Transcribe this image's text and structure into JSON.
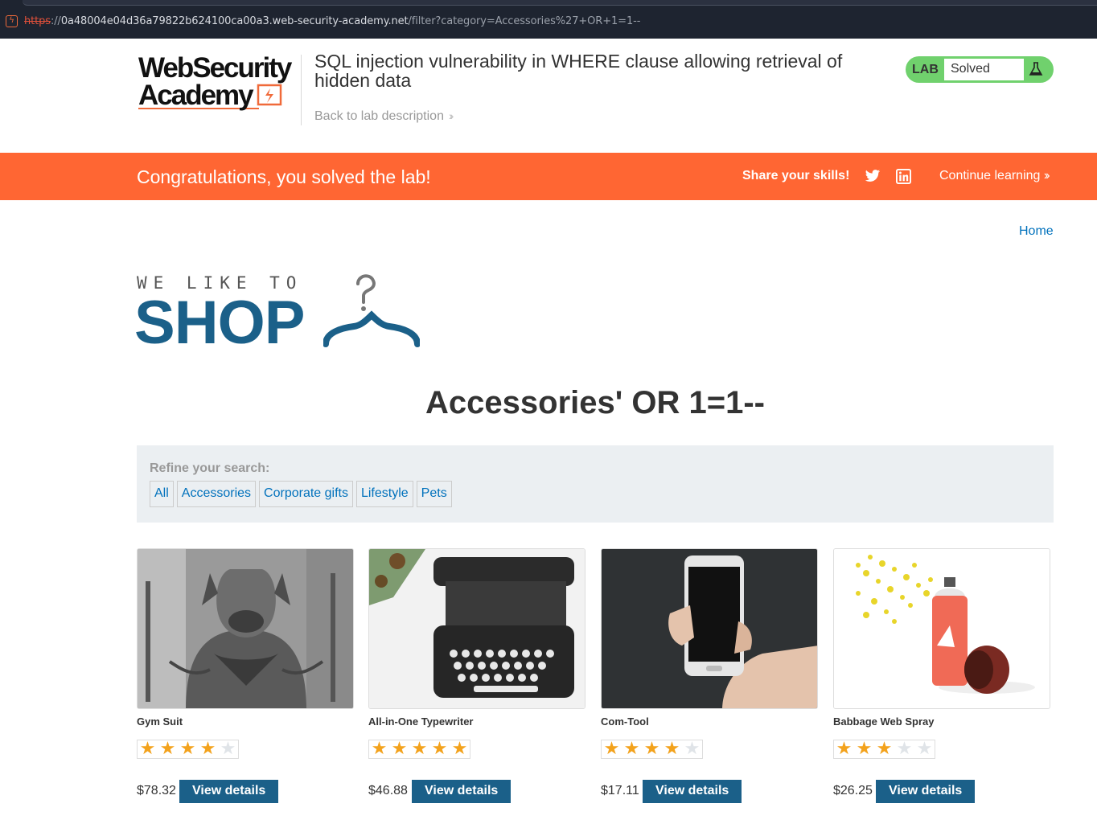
{
  "browser": {
    "url_protocol": "https",
    "url_sep": "://",
    "url_host": "0a48004e04d36a79822b624100ca00a3.web-security-academy.net",
    "url_path": "/filter?category=Accessories%27+OR+1=1--"
  },
  "academy": {
    "logo_line1": "WebSecurity",
    "logo_line2": "Academy",
    "lab_title": "SQL injection vulnerability in WHERE clause allowing retrieval of hidden data",
    "back_link": "Back to lab description",
    "lab_badge": "LAB",
    "lab_status": "Solved",
    "status_color": "#70d16d"
  },
  "banner": {
    "message": "Congratulations, you solved the lab!",
    "share_label": "Share your skills!",
    "continue_label": "Continue learning",
    "color": "#ff6633"
  },
  "shop": {
    "home_link": "Home",
    "logo_tagline": "WE LIKE TO",
    "logo_word": "SHOP",
    "page_title": "Accessories' OR 1=1--",
    "refine_label": "Refine your search:",
    "categories": [
      "All",
      "Accessories",
      "Corporate gifts",
      "Lifestyle",
      "Pets"
    ],
    "accent": "#1b6089",
    "products": [
      {
        "name": "Gym Suit",
        "rating": 4,
        "price": "$78.32",
        "button": "View details",
        "image": "bulldog-bodybuilder-photo"
      },
      {
        "name": "All-in-One Typewriter",
        "rating": 5,
        "price": "$46.88",
        "button": "View details",
        "image": "typewriter-photo"
      },
      {
        "name": "Com-Tool",
        "rating": 4,
        "price": "$17.11",
        "button": "View details",
        "image": "hand-holding-phone-photo"
      },
      {
        "name": "Babbage Web Spray",
        "rating": 3,
        "price": "$26.25",
        "button": "View details",
        "image": "spray-can-illustration"
      }
    ]
  }
}
